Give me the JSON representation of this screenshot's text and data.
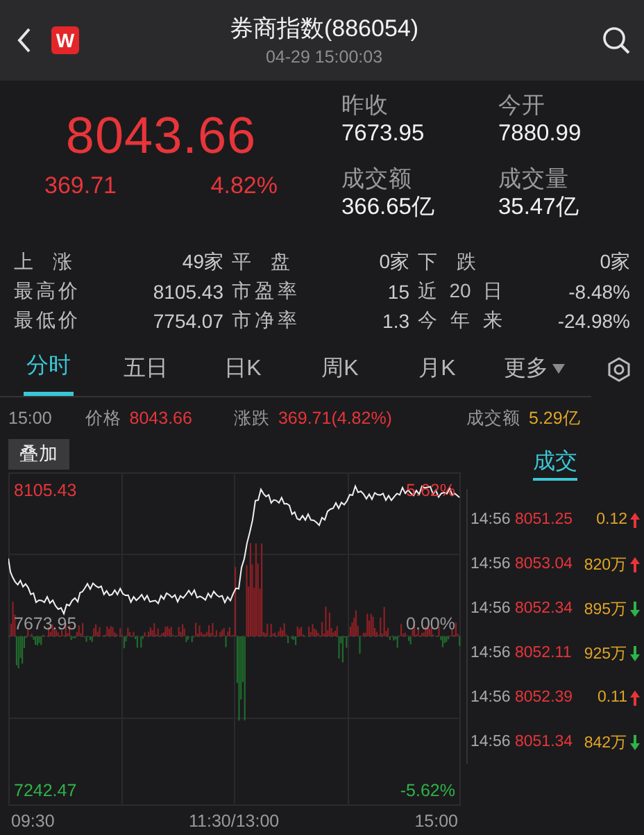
{
  "header": {
    "logo": "W",
    "title": "券商指数(886054)",
    "timestamp": "04-29 15:00:03"
  },
  "quote": {
    "price": "8043.66",
    "change": "369.71",
    "change_pct": "4.82%",
    "fields": [
      {
        "label": "昨收",
        "value": "7673.95"
      },
      {
        "label": "今开",
        "value": "7880.99"
      },
      {
        "label": "成交额",
        "value": "366.65亿"
      },
      {
        "label": "成交量",
        "value": "35.47亿"
      }
    ]
  },
  "stats": [
    [
      {
        "label": "上涨",
        "value": "49家"
      },
      {
        "label": "平盘",
        "value": "0家"
      },
      {
        "label": "下跌",
        "value": "0家"
      }
    ],
    [
      {
        "label": "最高价",
        "value": "8105.43"
      },
      {
        "label": "市盈率",
        "value": "15"
      },
      {
        "label": "近20日",
        "value": "-8.48%"
      }
    ],
    [
      {
        "label": "最低价",
        "value": "7754.07"
      },
      {
        "label": "市净率",
        "value": "1.3"
      },
      {
        "label": "今年来",
        "value": "-24.98%"
      }
    ]
  ],
  "tabs": [
    {
      "label": "分时",
      "selected": true,
      "kind": "plain"
    },
    {
      "label": "五日",
      "selected": false,
      "kind": "plain"
    },
    {
      "label": "日K",
      "selected": false,
      "kind": "plain"
    },
    {
      "label": "周K",
      "selected": false,
      "kind": "plain"
    },
    {
      "label": "月K",
      "selected": false,
      "kind": "plain"
    },
    {
      "label": "更多",
      "selected": false,
      "kind": "menu"
    }
  ],
  "chart": {
    "time": "15:00",
    "price_label": "价格",
    "price": "8043.66",
    "change_label": "涨跌",
    "change": "369.71(4.82%)",
    "overlay_button": "叠加",
    "high": "8105.43",
    "high_pct": "5.62%",
    "base": "7673.95",
    "base_pct": "0.00%",
    "low": "7242.47",
    "low_pct": "-5.62%",
    "x_labels": [
      "09:30",
      "11:30/13:00",
      "15:00"
    ]
  },
  "trades": {
    "amount_label": "成交额",
    "amount": "5.29亿",
    "tab": "成交",
    "rows": [
      {
        "time": "14:56",
        "price": "8051.25",
        "volume": "0.12",
        "up": true
      },
      {
        "time": "14:56",
        "price": "8053.04",
        "volume": "820万",
        "up": true
      },
      {
        "time": "14:56",
        "price": "8052.34",
        "volume": "895万",
        "up": false
      },
      {
        "time": "14:56",
        "price": "8052.11",
        "volume": "925万",
        "up": false
      },
      {
        "time": "14:56",
        "price": "8052.39",
        "volume": "0.11",
        "up": true
      },
      {
        "time": "14:56",
        "price": "8051.34",
        "volume": "842万",
        "up": false
      }
    ]
  }
}
